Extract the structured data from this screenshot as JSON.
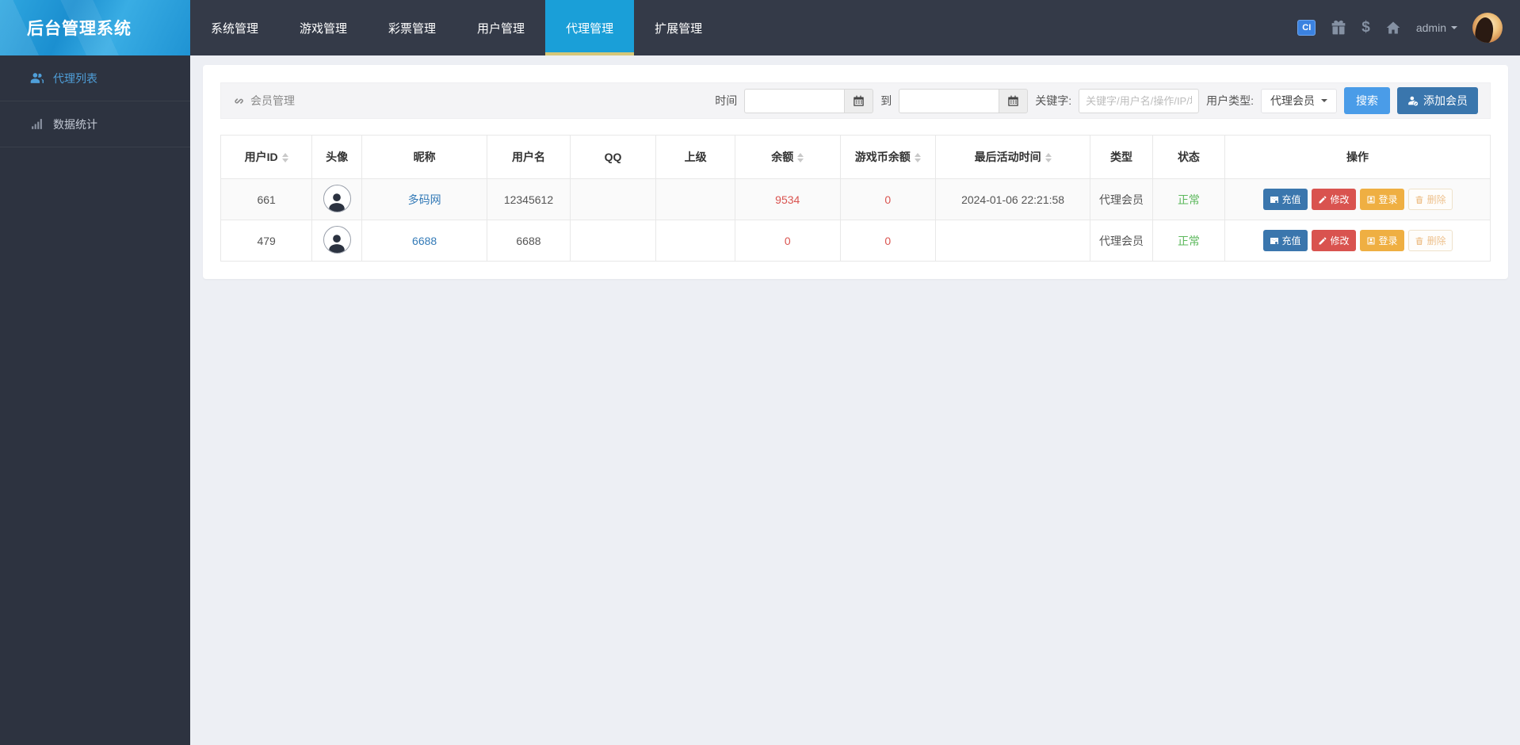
{
  "topbar": {
    "logo": "后台管理系统",
    "nav": [
      {
        "label": "系统管理"
      },
      {
        "label": "游戏管理"
      },
      {
        "label": "彩票管理"
      },
      {
        "label": "用户管理"
      },
      {
        "label": "代理管理",
        "active": true
      },
      {
        "label": "扩展管理"
      }
    ],
    "ci_badge": "CI",
    "dollar": "$",
    "icons": [
      "ci-badge-icon",
      "gift-icon",
      "dollar-icon",
      "home-icon"
    ],
    "username": "admin"
  },
  "sidebar": {
    "items": [
      {
        "label": "代理列表",
        "icon": "users-icon",
        "active": true
      },
      {
        "label": "数据统计",
        "icon": "bar-chart-icon",
        "active": false
      }
    ]
  },
  "panel": {
    "title": "会员管理",
    "filters": {
      "time_label": "时间",
      "date_from": "",
      "to_label": "到",
      "date_to": "",
      "keyword_label": "关键字:",
      "keyword_placeholder": "关键字/用户名/操作/IP/地址",
      "keyword_value": "",
      "user_type_label": "用户类型:",
      "user_type_value": "代理会员",
      "search_button": "搜索",
      "add_member_button": "添加会员"
    },
    "table": {
      "columns": [
        "用户ID",
        "头像",
        "昵称",
        "用户名",
        "QQ",
        "上级",
        "余额",
        "游戏币余额",
        "最后活动时间",
        "类型",
        "状态",
        "操作"
      ],
      "sortable_columns": [
        "用户ID",
        "余额",
        "游戏币余额",
        "最后活动时间"
      ],
      "actions": [
        "充值",
        "修改",
        "登录",
        "删除"
      ],
      "rows": [
        {
          "id": "661",
          "nickname": "多码网",
          "username": "12345612",
          "qq": "",
          "parent": "",
          "balance": "9534",
          "game_balance": "0",
          "last_active": "2024-01-06 22:21:58",
          "type": "代理会员",
          "status": "正常"
        },
        {
          "id": "479",
          "nickname": "6688",
          "username": "6688",
          "qq": "",
          "parent": "",
          "balance": "0",
          "game_balance": "0",
          "last_active": "",
          "type": "代理会员",
          "status": "正常"
        }
      ]
    }
  },
  "colors": {
    "accent_blue": "#1a9fd8",
    "tab_underline": "#d6c678",
    "button_steel_blue": "#3a76ad",
    "button_red": "#d9534f",
    "button_orange": "#efaf42",
    "status_green": "#5cb85c",
    "value_red": "#da5450",
    "link_blue": "#337ab7"
  }
}
